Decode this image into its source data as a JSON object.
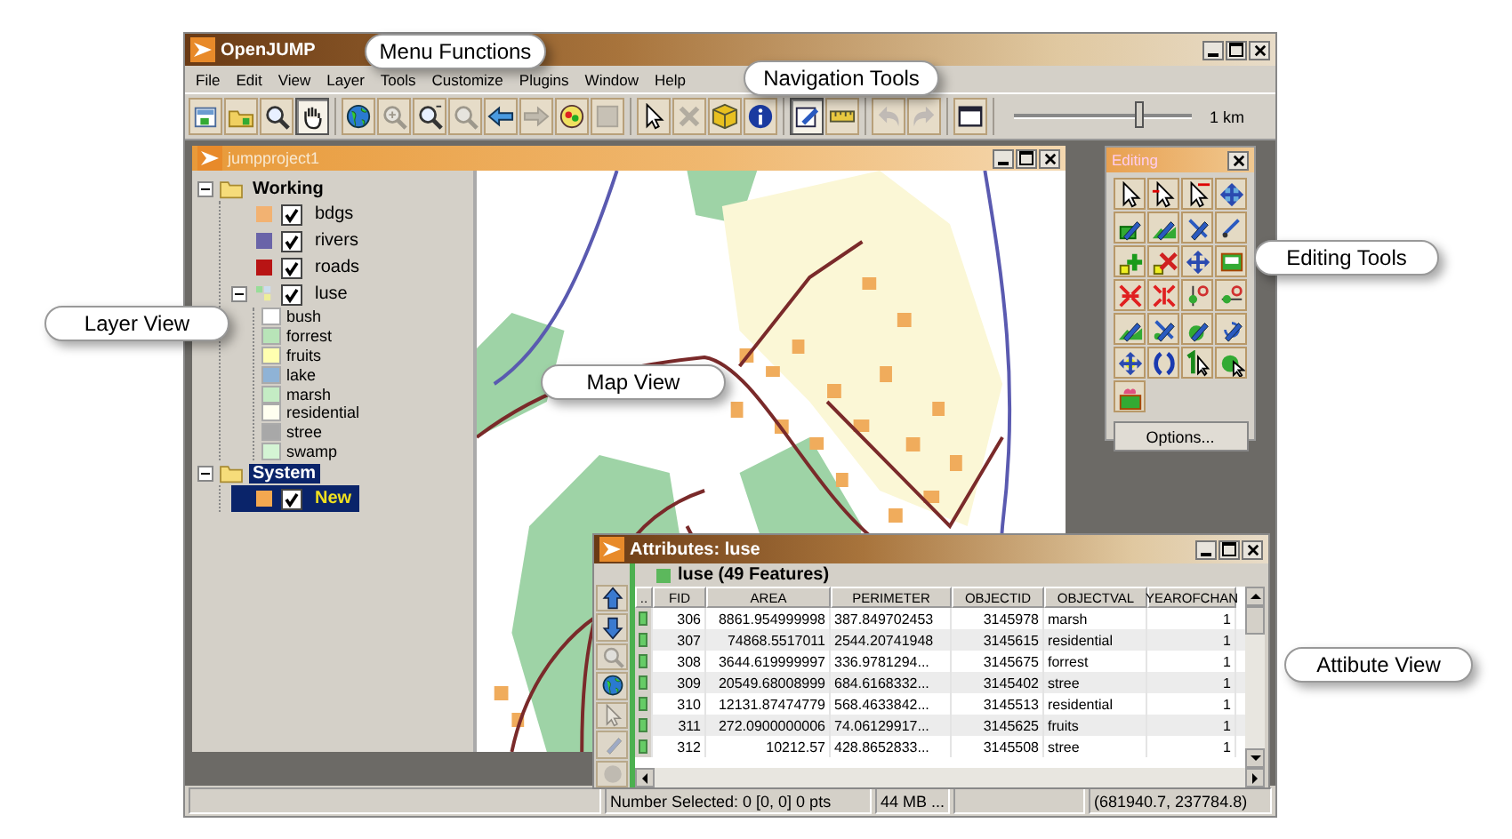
{
  "window": {
    "title": "OpenJUMP"
  },
  "menu": [
    "File",
    "Edit",
    "View",
    "Layer",
    "Tools",
    "Customize",
    "Plugins",
    "Window",
    "Help"
  ],
  "toolbar_buttons": [
    {
      "selected": false,
      "disabled": false
    },
    {
      "selected": false,
      "disabled": false
    },
    {
      "selected": false,
      "disabled": false
    },
    {
      "selected": true,
      "disabled": false
    },
    {
      "selected": false,
      "disabled": false
    },
    {
      "selected": false,
      "disabled": true
    },
    {
      "selected": false,
      "disabled": false
    },
    {
      "selected": false,
      "disabled": true
    },
    {
      "selected": false,
      "disabled": false
    },
    {
      "selected": false,
      "disabled": true
    },
    {
      "selected": false,
      "disabled": false
    },
    {
      "selected": false,
      "disabled": true
    },
    {
      "selected": false,
      "disabled": false
    },
    {
      "selected": false,
      "disabled": true
    },
    {
      "selected": false,
      "disabled": false
    },
    {
      "selected": false,
      "disabled": false
    },
    {
      "selected": true,
      "disabled": false
    },
    {
      "selected": false,
      "disabled": false
    },
    {
      "selected": false,
      "disabled": true
    },
    {
      "selected": false,
      "disabled": true
    },
    {
      "selected": false,
      "disabled": false
    }
  ],
  "scale": {
    "level": 0.7,
    "label": "1 km"
  },
  "project_window": {
    "title": "jumpproject1"
  },
  "layer_tree": [
    {
      "label": "Working",
      "expanded": true,
      "selected": false,
      "children": [
        {
          "kind": "layer",
          "label": "bdgs",
          "color": "#f2b272",
          "checked": true,
          "selected": false,
          "editable": false
        },
        {
          "kind": "layer",
          "label": "rivers",
          "color": "#6a64a8",
          "checked": true,
          "selected": false,
          "editable": false
        },
        {
          "kind": "layer",
          "label": "roads",
          "color": "#b81414",
          "checked": true,
          "selected": false,
          "editable": false
        },
        {
          "kind": "theme",
          "label": "luse",
          "checked": true,
          "selected": false,
          "editable": false,
          "expanded": true,
          "children": [
            {
              "label": "bush",
              "color": "#ffffff"
            },
            {
              "label": "forrest",
              "color": "#b8e4b8"
            },
            {
              "label": "fruits",
              "color": "#ffffb0"
            },
            {
              "label": "lake",
              "color": "#8fb3d6"
            },
            {
              "label": "marsh",
              "color": "#c4ecc4"
            },
            {
              "label": "residential",
              "color": "#fffff0"
            },
            {
              "label": "stree",
              "color": "#a8a8a8"
            },
            {
              "label": "swamp",
              "color": "#d4f4d4"
            }
          ]
        }
      ]
    },
    {
      "label": "System",
      "expanded": true,
      "selected": true,
      "children": [
        {
          "kind": "layer",
          "label": "New",
          "color": "#f4a850",
          "checked": true,
          "selected": true,
          "editable": true
        }
      ]
    }
  ],
  "editing_palette": {
    "title": "Editing",
    "button": "Options..."
  },
  "attributes": {
    "title": "Attributes: luse",
    "layer": "luse (49 Features)",
    "selector_header": "..",
    "columns": [
      "FID",
      "AREA",
      "PERIMETER",
      "OBJECTID",
      "OBJECTVAL",
      "YEAROFCHAN"
    ],
    "rows": [
      [
        "306",
        "8861.954999998",
        "387.849702453",
        "3145978",
        "marsh",
        "1"
      ],
      [
        "307",
        "74868.5517011",
        "2544.20741948",
        "3145615",
        "residential",
        "1"
      ],
      [
        "308",
        "3644.619999997",
        "336.9781294...",
        "3145675",
        "forrest",
        "1"
      ],
      [
        "309",
        "20549.68008999",
        "684.6168332...",
        "3145402",
        "stree",
        "1"
      ],
      [
        "310",
        "12131.87474779",
        "568.4633842...",
        "3145513",
        "residential",
        "1"
      ],
      [
        "311",
        "272.0900000006",
        "74.06129917...",
        "3145625",
        "fruits",
        "1"
      ],
      [
        "312",
        "10212.57",
        "428.8652833...",
        "3145508",
        "stree",
        "1"
      ]
    ]
  },
  "status_bar": {
    "selection": "Number Selected: 0 [0, 0] 0 pts",
    "memory": "44 MB ...",
    "coordinates": "(681940.7, 237784.8)"
  },
  "callouts": [
    {
      "kind": "menu",
      "label": "Menu Functions"
    },
    {
      "kind": "navigation",
      "label": "Navigation Tools"
    },
    {
      "kind": "layers",
      "label": "Layer View"
    },
    {
      "kind": "map",
      "label": "Map View"
    },
    {
      "kind": "editing",
      "label": "Editing Tools"
    },
    {
      "kind": "attributes",
      "label": "Attibute View"
    }
  ]
}
